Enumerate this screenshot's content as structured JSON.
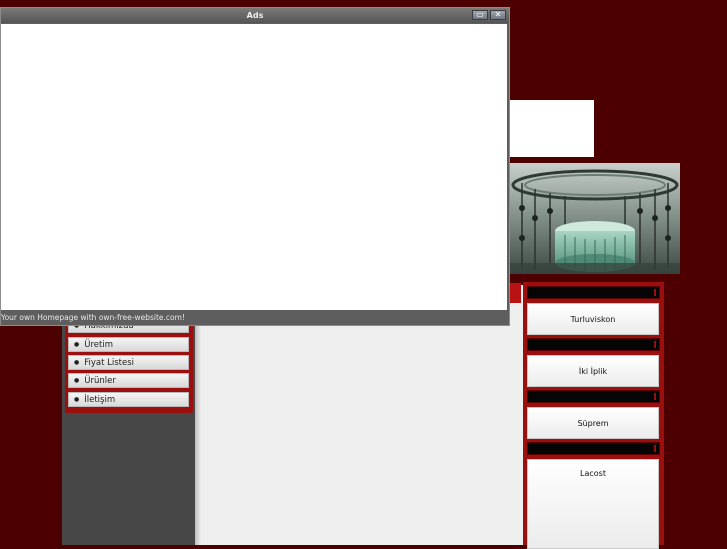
{
  "ads_window": {
    "title": "Ads",
    "footer_text": "Your own Homepage with own-free-website.com!",
    "minimize_glyph": "▭",
    "close_glyph": "✕"
  },
  "menu": {
    "items": [
      {
        "label": "Hakkımızda"
      },
      {
        "label": "Üretim"
      },
      {
        "label": "Fiyat Listesi"
      },
      {
        "label": "Ürünler"
      },
      {
        "label": "İletişim"
      }
    ]
  },
  "products": [
    {
      "label": "Turluviskon"
    },
    {
      "label": "İki İplik"
    },
    {
      "label": "Süprem"
    },
    {
      "label": "Lacost"
    }
  ],
  "colors": {
    "page_bg": "#4d0000",
    "accent_red": "#9b0f0f",
    "sidebar_gray": "#474747"
  },
  "icons": {
    "menu_bullet": "bullet-icon"
  }
}
